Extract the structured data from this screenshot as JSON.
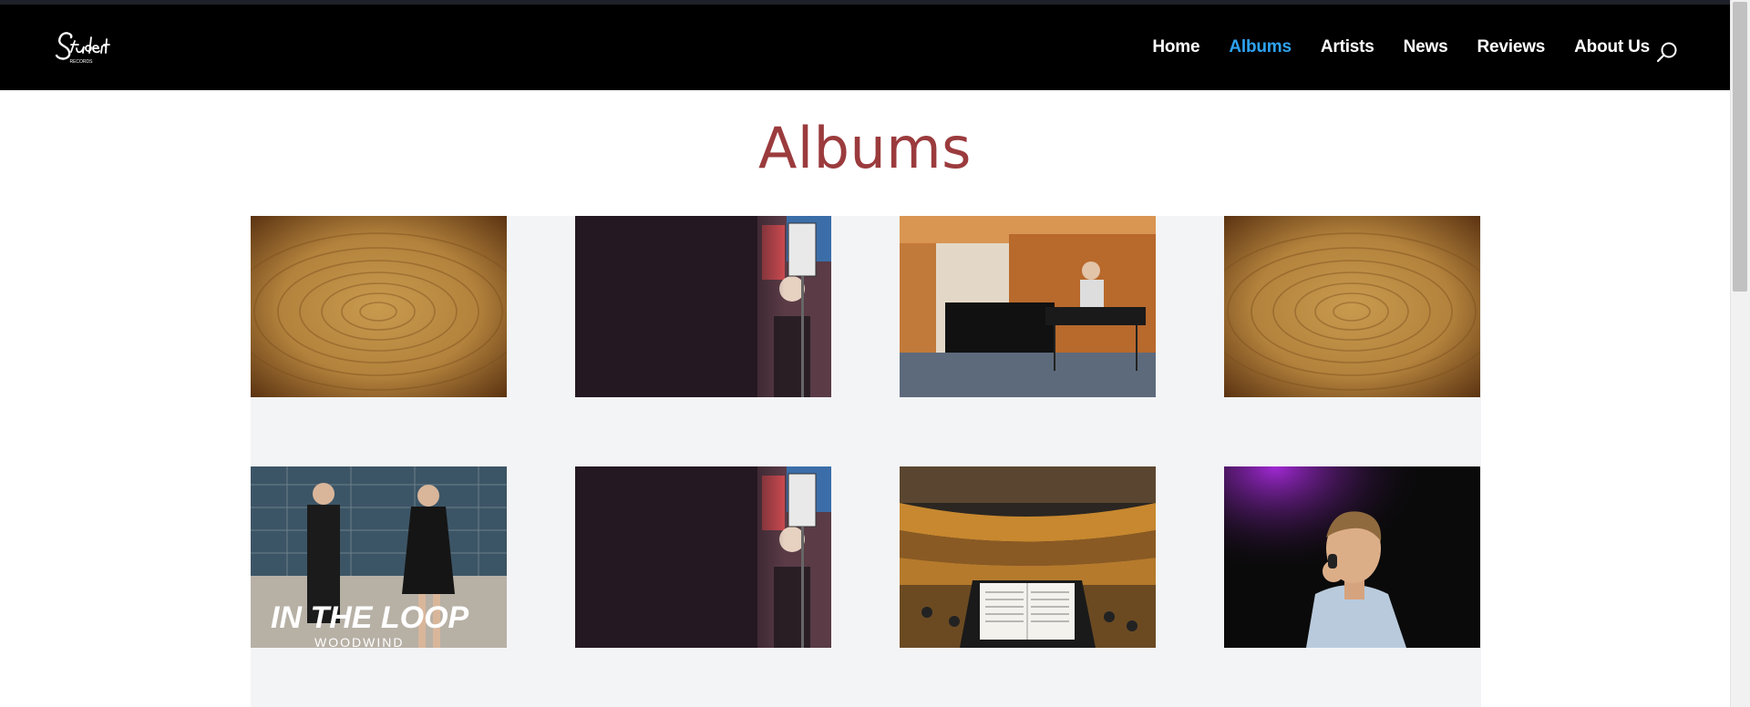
{
  "header": {
    "logo_text": "Student",
    "logo_subtext": "RECORDS",
    "nav": [
      {
        "label": "Home",
        "active": false
      },
      {
        "label": "Albums",
        "active": true
      },
      {
        "label": "Artists",
        "active": false
      },
      {
        "label": "News",
        "active": false
      },
      {
        "label": "Reviews",
        "active": false
      },
      {
        "label": "About Us",
        "active": false
      }
    ]
  },
  "page": {
    "title": "Albums"
  },
  "albums": [
    {
      "art": "wood-rings"
    },
    {
      "art": "graffiti-duo-dark"
    },
    {
      "art": "piano-studio"
    },
    {
      "art": "wood-rings"
    },
    {
      "art": "in-the-loop-duo",
      "cover_title": "IN THE LOOP",
      "cover_subtitle": "WOODWIND"
    },
    {
      "art": "graffiti-duo-dark"
    },
    {
      "art": "concert-hall-score"
    },
    {
      "art": "singer-microphone"
    }
  ],
  "colors": {
    "header_bg": "#000000",
    "nav_active": "#2ea3f2",
    "title": "#9b3b3d",
    "grid_bg": "#f3f4f6"
  }
}
